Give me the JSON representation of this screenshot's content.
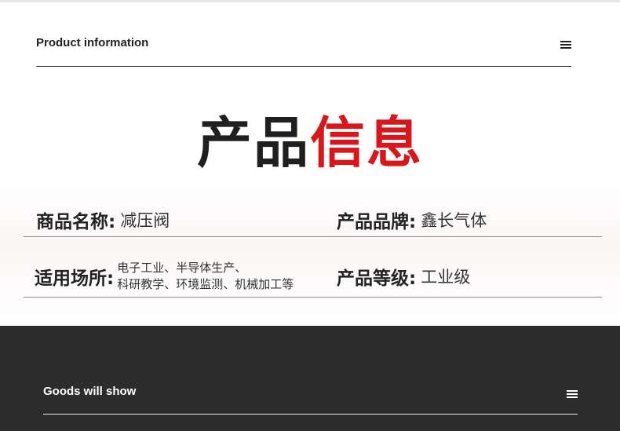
{
  "header": {
    "title": "Product information"
  },
  "big_title": {
    "dark_part": "产品",
    "red_part": "信息",
    "accent_color": "#d8161b"
  },
  "info": {
    "name_label": "商品名称:",
    "name_value": "减压阀",
    "brand_label": "产品品牌:",
    "brand_value": "鑫长气体",
    "usage_label": "适用场所:",
    "usage_line1": "电子工业、半导体生产、",
    "usage_line2": "科研教学、环境监测、机械加工等",
    "grade_label": "产品等级:",
    "grade_value": "工业级"
  },
  "footer": {
    "title": "Goods will show"
  },
  "icons": {
    "menu": "hamburger-menu-icon"
  }
}
